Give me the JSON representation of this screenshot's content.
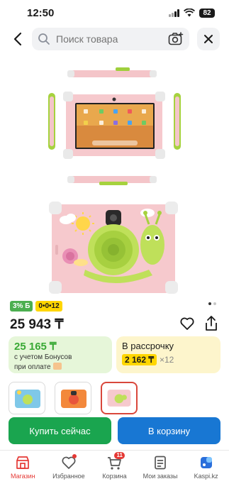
{
  "status": {
    "time": "12:50",
    "battery": "82"
  },
  "search": {
    "placeholder": "Поиск товара"
  },
  "icons": {
    "back": "chevron-left-icon",
    "search": "search-icon",
    "camera": "camera-search-icon",
    "close": "close-icon",
    "favorite": "heart-icon",
    "share": "share-icon"
  },
  "product": {
    "badges": {
      "percent": "3% Б",
      "installment": "0•0•12"
    },
    "price": "25 943 ₸",
    "bonus_card": {
      "amount": "25 165 ₸",
      "line1": "с учетом Бонусов",
      "line2": "при оплате"
    },
    "credit_card": {
      "label": "В рассрочку",
      "amount": "2 162 ₸",
      "multiplier": "×12"
    },
    "gallery": {
      "dots": 2,
      "active_index": 1
    }
  },
  "actions": {
    "buy": "Купить сейчас",
    "cart": "В корзину"
  },
  "nav": {
    "items": [
      {
        "label": "Магазин",
        "icon": "shop-icon"
      },
      {
        "label": "Избранное",
        "icon": "heart-icon"
      },
      {
        "label": "Корзина",
        "icon": "cart-icon",
        "badge": "11"
      },
      {
        "label": "Мои заказы",
        "icon": "orders-icon"
      },
      {
        "label": "Kaspi.kz",
        "icon": "kaspi-icon"
      }
    ]
  },
  "colors": {
    "accent_green": "#1aa54f",
    "accent_blue": "#1877d3",
    "active_red": "#e53935"
  }
}
